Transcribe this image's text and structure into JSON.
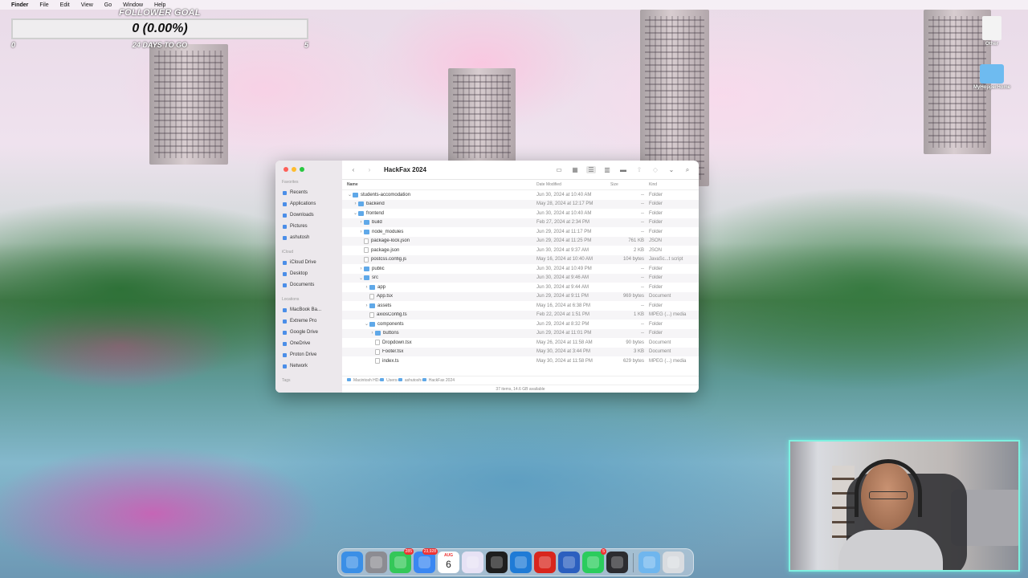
{
  "menubar": [
    "Finder",
    "File",
    "Edit",
    "View",
    "Go",
    "Window",
    "Help"
  ],
  "overlay": {
    "title": "FOLLOWER GOAL",
    "value": "0 (0.00%)",
    "start": "0",
    "days": "24 DAYS TO GO",
    "target": "5"
  },
  "desktop_icons": [
    {
      "label": "Other"
    },
    {
      "label": "MyHopperHome"
    }
  ],
  "finder": {
    "title": "HackFax 2024",
    "sidebar": {
      "favorites_label": "Favorites",
      "favorites": [
        "Recents",
        "Applications",
        "Downloads",
        "Pictures",
        "ashutosh"
      ],
      "icloud_label": "iCloud",
      "icloud": [
        "iCloud Drive",
        "Desktop",
        "Documents"
      ],
      "locations_label": "Locations",
      "locations": [
        "MacBook Ba...",
        "Extreme Pro",
        "Google Drive",
        "OneDrive",
        "Proton Drive",
        "Network"
      ],
      "tags_label": "Tags"
    },
    "columns": {
      "name": "Name",
      "date": "Date Modified",
      "size": "Size",
      "kind": "Kind"
    },
    "rows": [
      {
        "name": "students-accomodation",
        "date": "Jun 30, 2024 at 10:40 AM",
        "size": "--",
        "kind": "Folder",
        "type": "folder",
        "depth": 0,
        "open": true
      },
      {
        "name": "backend",
        "date": "May 28, 2024 at 12:17 PM",
        "size": "--",
        "kind": "Folder",
        "type": "folder",
        "depth": 1,
        "open": false
      },
      {
        "name": "frontend",
        "date": "Jun 30, 2024 at 10:40 AM",
        "size": "--",
        "kind": "Folder",
        "type": "folder",
        "depth": 1,
        "open": true
      },
      {
        "name": "build",
        "date": "Feb 27, 2024 at 2:34 PM",
        "size": "--",
        "kind": "Folder",
        "type": "folder",
        "depth": 2,
        "open": false
      },
      {
        "name": "node_modules",
        "date": "Jun 29, 2024 at 11:17 PM",
        "size": "--",
        "kind": "Folder",
        "type": "folder",
        "depth": 2,
        "open": false
      },
      {
        "name": "package-lock.json",
        "date": "Jun 29, 2024 at 11:25 PM",
        "size": "761 KB",
        "kind": "JSON",
        "type": "file",
        "depth": 2
      },
      {
        "name": "package.json",
        "date": "Jun 30, 2024 at 9:37 AM",
        "size": "2 KB",
        "kind": "JSON",
        "type": "file",
        "depth": 2
      },
      {
        "name": "postcss.config.js",
        "date": "May 16, 2024 at 10:40 AM",
        "size": "104 bytes",
        "kind": "JavaSc...t script",
        "type": "file",
        "depth": 2
      },
      {
        "name": "public",
        "date": "Jun 30, 2024 at 10:49 PM",
        "size": "--",
        "kind": "Folder",
        "type": "folder",
        "depth": 2,
        "open": false
      },
      {
        "name": "src",
        "date": "Jun 30, 2024 at 9:46 AM",
        "size": "--",
        "kind": "Folder",
        "type": "folder",
        "depth": 2,
        "open": true
      },
      {
        "name": "app",
        "date": "Jun 30, 2024 at 9:44 AM",
        "size": "--",
        "kind": "Folder",
        "type": "folder",
        "depth": 3,
        "open": false
      },
      {
        "name": "App.tsx",
        "date": "Jun 29, 2024 at 9:11 PM",
        "size": "969 bytes",
        "kind": "Document",
        "type": "file",
        "depth": 3
      },
      {
        "name": "assets",
        "date": "May 16, 2024 at 6:38 PM",
        "size": "--",
        "kind": "Folder",
        "type": "folder",
        "depth": 3,
        "open": false
      },
      {
        "name": "axiosConfig.ts",
        "date": "Feb 22, 2024 at 1:51 PM",
        "size": "1 KB",
        "kind": "MPEG (...) media",
        "type": "file",
        "depth": 3
      },
      {
        "name": "components",
        "date": "Jun 29, 2024 at 8:32 PM",
        "size": "--",
        "kind": "Folder",
        "type": "folder",
        "depth": 3,
        "open": true
      },
      {
        "name": "buttons",
        "date": "Jun 29, 2024 at 11:01 PM",
        "size": "--",
        "kind": "Folder",
        "type": "folder",
        "depth": 4,
        "open": false
      },
      {
        "name": "Dropdown.tsx",
        "date": "May 26, 2024 at 11:58 AM",
        "size": "90 bytes",
        "kind": "Document",
        "type": "file",
        "depth": 4
      },
      {
        "name": "Footer.tsx",
        "date": "May 30, 2024 at 3:44 PM",
        "size": "3 KB",
        "kind": "Document",
        "type": "file",
        "depth": 4
      },
      {
        "name": "index.ts",
        "date": "May 30, 2024 at 11:58 PM",
        "size": "629 bytes",
        "kind": "MPEG (...) media",
        "type": "file",
        "depth": 4
      }
    ],
    "path": [
      "Macintosh HD",
      "Users",
      "ashutosh",
      "HackFax 2024"
    ],
    "status": "37 items, 14.6 GB available"
  },
  "dock": {
    "apps": [
      {
        "name": "finder",
        "color": "#3b8fe6"
      },
      {
        "name": "system-settings",
        "color": "#8c8c92"
      },
      {
        "name": "messages",
        "color": "#34c759",
        "badge": "285"
      },
      {
        "name": "mail",
        "color": "#3a87f2",
        "badge": "23,928"
      },
      {
        "name": "calendar",
        "color": "#ffffff",
        "month": "AUG",
        "day": "6"
      },
      {
        "name": "figma",
        "color": "#e7e2f5"
      },
      {
        "name": "terminal",
        "color": "#1e1e1e"
      },
      {
        "name": "vscode",
        "color": "#1f7bd6"
      },
      {
        "name": "acrobat",
        "color": "#d8261d"
      },
      {
        "name": "word",
        "color": "#2b5fbf"
      },
      {
        "name": "whatsapp",
        "color": "#2bcc5d",
        "badge": "5"
      },
      {
        "name": "copilot",
        "color": "#2c2c30"
      },
      {
        "name": "downloads-folder",
        "color": "#6fb6ee"
      },
      {
        "name": "trash",
        "color": "#d9dce0"
      }
    ]
  }
}
